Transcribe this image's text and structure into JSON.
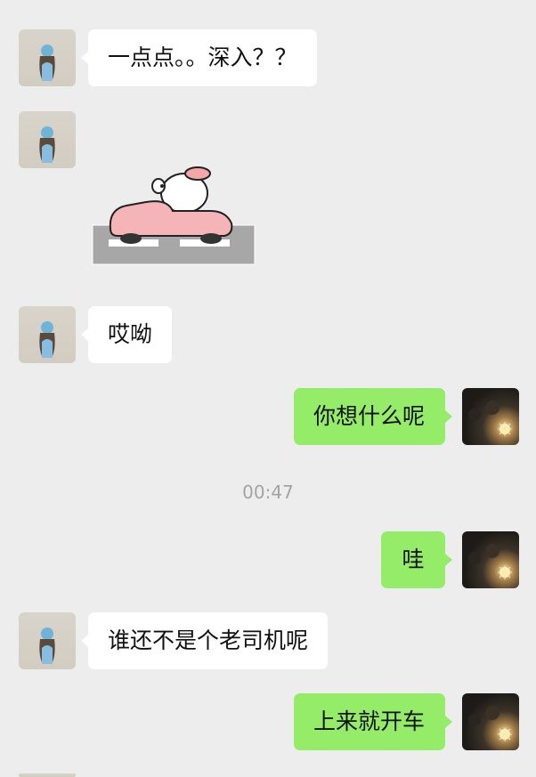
{
  "messages": [
    {
      "side": "left",
      "text": "一点点。。深入？？"
    },
    {
      "side": "left",
      "type": "sticker",
      "sticker": "pink-car-cat-sticker"
    },
    {
      "side": "left",
      "text": "哎呦"
    },
    {
      "side": "right",
      "text": "你想什么呢"
    },
    {
      "side": "right",
      "text": "哇"
    },
    {
      "side": "left",
      "text": "谁还不是个老司机呢"
    },
    {
      "side": "right",
      "text": "上来就开车"
    }
  ],
  "timestamp": "00:47",
  "colors": {
    "background": "#ededed",
    "incoming_bubble": "#ffffff",
    "outgoing_bubble": "#95ec69",
    "timestamp_text": "#a3a3a3"
  }
}
